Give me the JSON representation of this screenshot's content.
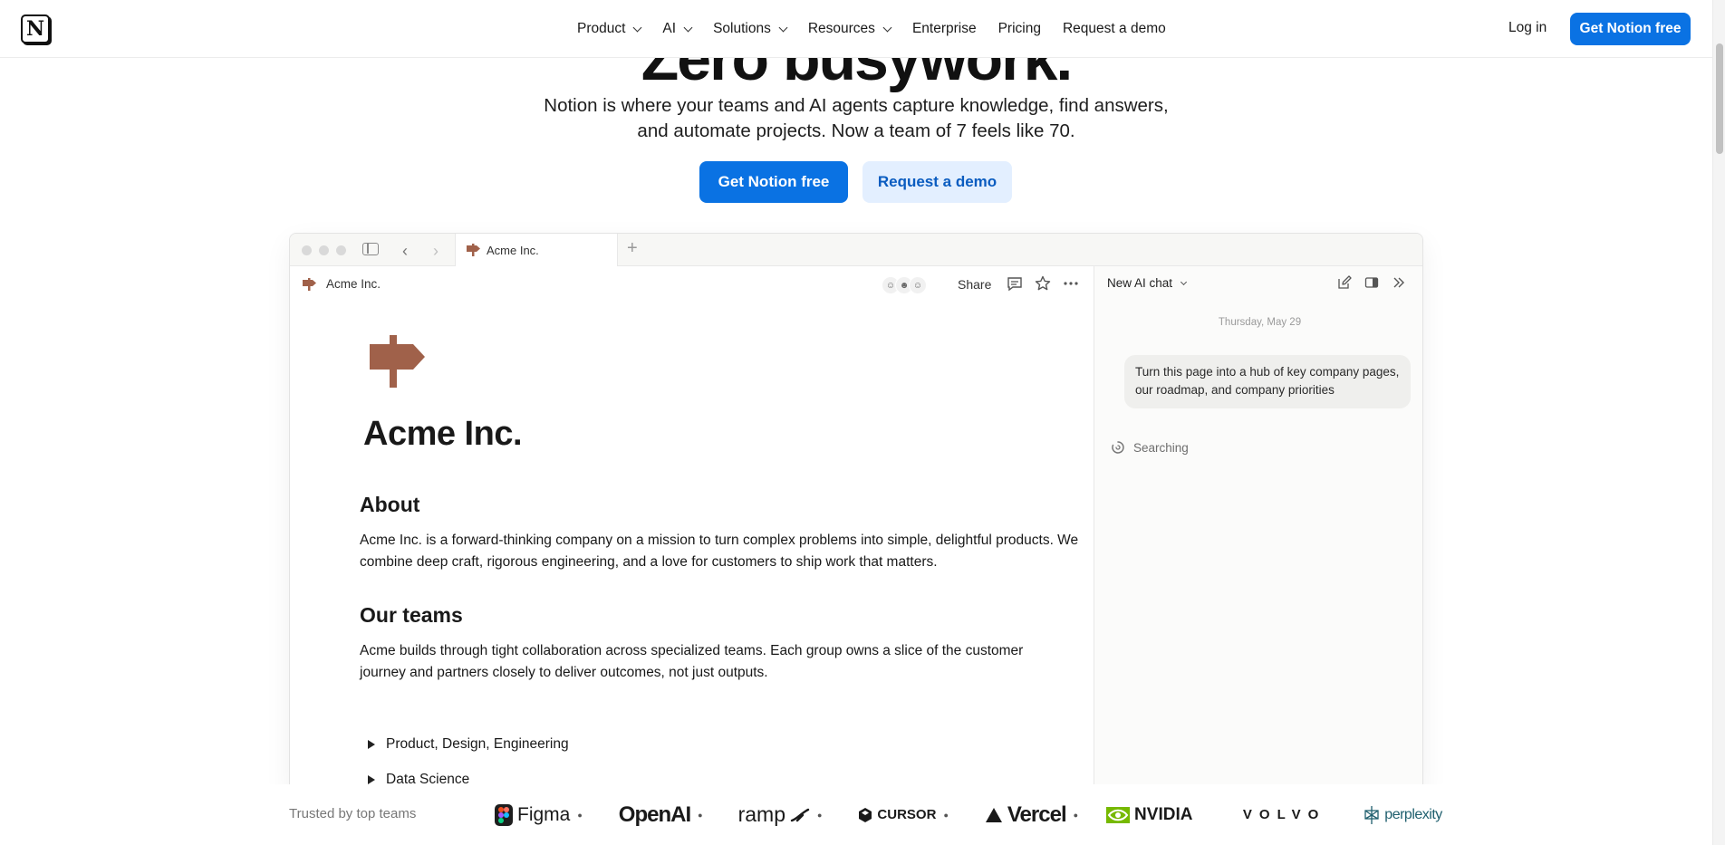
{
  "nav": {
    "logo": "N",
    "items": [
      {
        "label": "Product",
        "dropdown": true
      },
      {
        "label": "AI",
        "dropdown": true
      },
      {
        "label": "Solutions",
        "dropdown": true
      },
      {
        "label": "Resources",
        "dropdown": true
      },
      {
        "label": "Enterprise",
        "dropdown": false
      },
      {
        "label": "Pricing",
        "dropdown": false
      },
      {
        "label": "Request a demo",
        "dropdown": false
      }
    ],
    "login": "Log in",
    "cta": "Get Notion free"
  },
  "hero": {
    "title": "Zero busywork.",
    "subtitle": "Notion is where your teams and AI agents capture knowledge, find answers, and automate projects. Now a team of 7 feels like 70.",
    "primary_button": "Get Notion free",
    "secondary_button": "Request a demo"
  },
  "app": {
    "tab_label": "Acme Inc.",
    "page": {
      "breadcrumb": "Acme Inc.",
      "share": "Share",
      "title": "Acme Inc.",
      "about_heading": "About",
      "about_text": "Acme Inc. is a forward-thinking company on a mission to turn complex problems into simple, delightful products. We combine deep craft, rigorous engineering, and a love for customers to ship work that matters.",
      "teams_heading": "Our teams",
      "teams_text": "Acme builds through tight collaboration across specialized teams. Each group owns a slice of the customer journey and partners closely to deliver outcomes, not just outputs.",
      "toggles": [
        "Product, Design, Engineering",
        "Data Science"
      ]
    },
    "ai": {
      "title": "New AI chat",
      "date": "Thursday, May 29",
      "message": "Turn this page into a hub of key company pages, our roadmap, and company priorities",
      "status": "Searching"
    }
  },
  "trusted": {
    "label": "Trusted by top teams",
    "logos": [
      "Figma",
      "OpenAI",
      "ramp",
      "CURSOR",
      "Vercel",
      "NVIDIA",
      "VOLVO",
      "perplexity"
    ]
  },
  "colors": {
    "accent": "#0a72e3",
    "accent_soft": "#e3efff",
    "signpost": "#a0614a"
  }
}
